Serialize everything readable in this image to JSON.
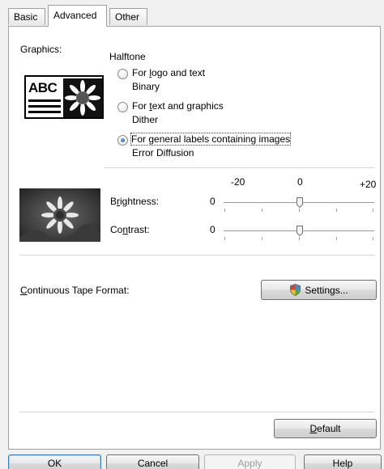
{
  "tabs": [
    {
      "label": "Basic"
    },
    {
      "label": "Advanced"
    },
    {
      "label": "Other"
    }
  ],
  "graphics": {
    "label": "Graphics:",
    "halftone_label": "Halftone",
    "options": [
      {
        "label": "For logo and text",
        "underline": "l",
        "sub": "Binary",
        "checked": false
      },
      {
        "label": "For text and graphics",
        "underline": "t",
        "sub": "Dither",
        "checked": false
      },
      {
        "label": "For general labels containing images",
        "underline": "g",
        "sub": "Error Diffusion",
        "checked": true
      }
    ],
    "abc_label": "ABC"
  },
  "adjust": {
    "scale_min": "-20",
    "scale_mid": "0",
    "scale_max": "+20",
    "brightness": {
      "label": "Brightness:",
      "value": "0"
    },
    "contrast": {
      "label": "Contrast:",
      "value": "0"
    }
  },
  "tape": {
    "label": "Continuous Tape Format:",
    "settings_button": "Settings..."
  },
  "default_button": "Default",
  "footer": {
    "ok": "OK",
    "cancel": "Cancel",
    "apply": "Apply",
    "help": "Help"
  },
  "icons": [
    "shield-icon",
    "sunflower-photo"
  ]
}
